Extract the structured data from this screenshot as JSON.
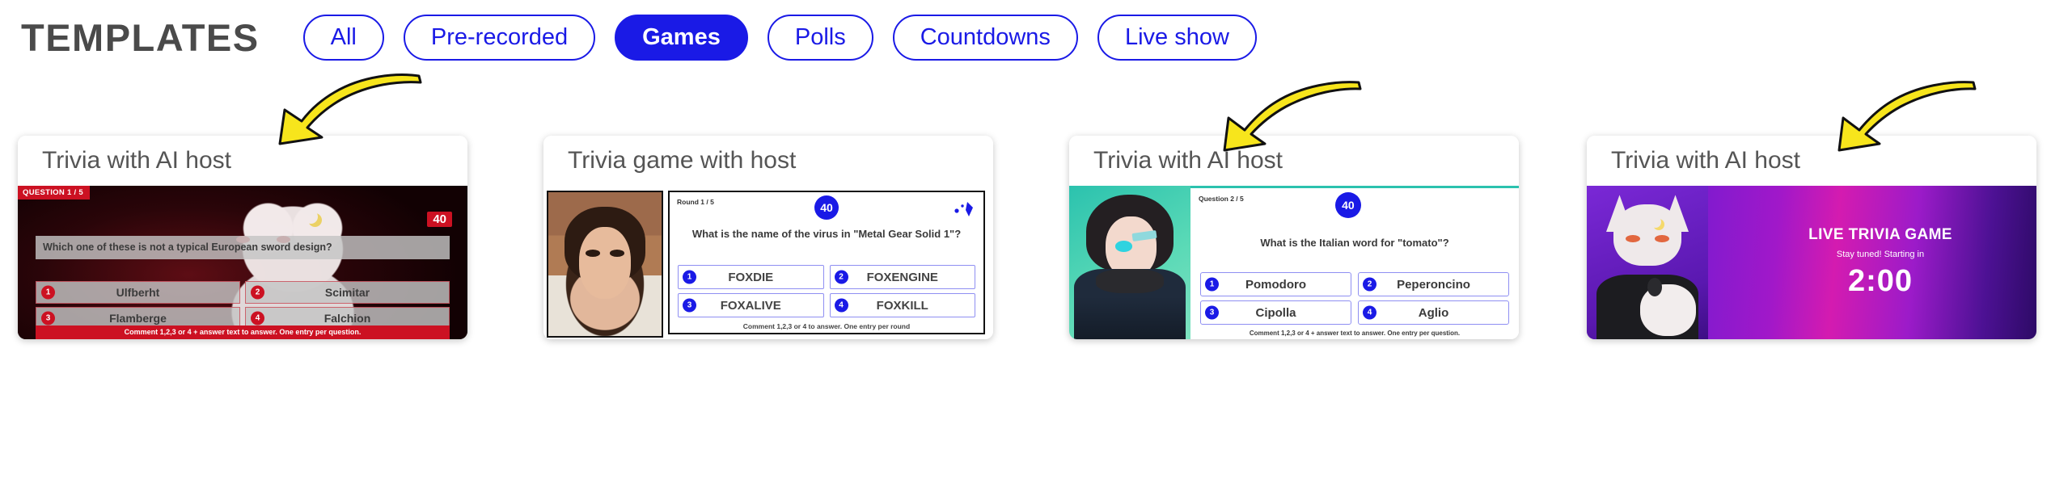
{
  "header": {
    "title": "TEMPLATES",
    "filters": [
      {
        "label": "All",
        "active": false
      },
      {
        "label": "Pre-recorded",
        "active": false
      },
      {
        "label": "Games",
        "active": true
      },
      {
        "label": "Polls",
        "active": false
      },
      {
        "label": "Countdowns",
        "active": false
      },
      {
        "label": "Live show",
        "active": false
      }
    ]
  },
  "cards": [
    {
      "title": "Trivia with AI host",
      "badge": "QUESTION 1 / 5",
      "timer": "40",
      "question": "Which one of these is not a typical European sword design?",
      "answers": [
        {
          "num": "1",
          "label": "Ulfberht"
        },
        {
          "num": "2",
          "label": "Scimitar"
        },
        {
          "num": "3",
          "label": "Flamberge"
        },
        {
          "num": "4",
          "label": "Falchion"
        }
      ],
      "footer": "Comment 1,2,3 or 4 + answer text to answer. One entry per question."
    },
    {
      "title": "Trivia game with host",
      "badge": "Round 1 / 5",
      "timer": "40",
      "question": "What is the name of the virus in \"Metal Gear Solid 1\"?",
      "answers": [
        {
          "num": "1",
          "label": "FOXDIE"
        },
        {
          "num": "2",
          "label": "FOXENGINE"
        },
        {
          "num": "3",
          "label": "FOXALIVE"
        },
        {
          "num": "4",
          "label": "FOXKILL"
        }
      ],
      "footer": "Comment 1,2,3 or 4 to answer. One entry per round"
    },
    {
      "title": "Trivia with AI host",
      "badge": "Question 2 / 5",
      "timer": "40",
      "question": "What is the Italian word for \"tomato\"?",
      "answers": [
        {
          "num": "1",
          "label": "Pomodoro"
        },
        {
          "num": "2",
          "label": "Peperoncino"
        },
        {
          "num": "3",
          "label": "Cipolla"
        },
        {
          "num": "4",
          "label": "Aglio"
        }
      ],
      "footer": "Comment 1,2,3 or 4 + answer text to answer. One entry per question."
    },
    {
      "title": "Trivia with AI host",
      "countdown": {
        "heading": "LIVE TRIVIA GAME",
        "subheading": "Stay tuned! Starting in",
        "clock": "2:00"
      }
    }
  ],
  "annotations": {
    "arrow_color": "#F7E51C",
    "arrows": [
      "pointer-arrow-card-1",
      "pointer-arrow-card-3",
      "pointer-arrow-card-4"
    ]
  },
  "colors": {
    "accent_blue": "#1A1AE6",
    "accent_red": "#CC1122",
    "title_gray": "#4A4A4A",
    "card_title_gray": "#555555"
  }
}
